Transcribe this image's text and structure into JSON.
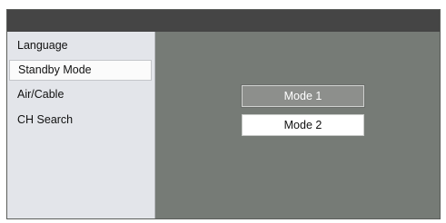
{
  "sidebar": {
    "items": [
      {
        "label": "Language"
      },
      {
        "label": "Standby Mode"
      },
      {
        "label": "Air/Cable"
      },
      {
        "label": "CH Search"
      }
    ]
  },
  "main": {
    "options": [
      {
        "label": "Mode 1"
      },
      {
        "label": "Mode 2"
      }
    ]
  },
  "colors": {
    "topbar": "#454545",
    "content_background": "#767b76",
    "sidebar_background": "#e3e5ea",
    "focused_option": "#8d8f8c"
  }
}
